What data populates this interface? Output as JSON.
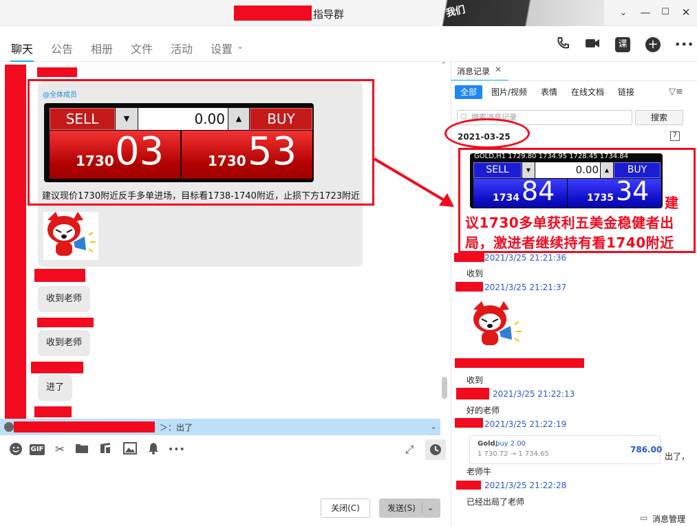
{
  "window": {
    "title": "指导群",
    "banner_text": "我们"
  },
  "tabs": [
    "聊天",
    "公告",
    "相册",
    "文件",
    "活动",
    "设置"
  ],
  "messages": {
    "mention": "@全体成员",
    "trade1": {
      "sell": "SELL",
      "buy": "BUY",
      "qty": "0.00",
      "sell_small": "1730",
      "sell_big": "03",
      "buy_small": "1730",
      "buy_big": "53"
    },
    "text1": "建议现价1730附近反手多单进场，目标看1738-1740附近，止损下方1723附近",
    "reply1": "收到老师",
    "reply2": "收到老师",
    "reply3": "进了",
    "notify": "＞：出了"
  },
  "buttons": {
    "close": "关闭(C)",
    "send": "发送(S)"
  },
  "history": {
    "tab_label": "消息记录",
    "filters": [
      "全部",
      "图片/视频",
      "表情",
      "在线文档",
      "链接"
    ],
    "search_placeholder": "搜索消息记录",
    "search_btn": "搜索",
    "date": "2021-03-25",
    "trade2": {
      "header": "GOLD,H1  1729.80 1734.95 1728.45 1734.84",
      "sell": "SELL",
      "buy": "BUY",
      "qty": "0.00",
      "sell_small": "1734",
      "sell_big": "84",
      "buy_small": "1735",
      "buy_big": "34"
    },
    "overlay": "建议1730多单获利五美金稳健者出局，激进者继续持有看1740附近",
    "entries": [
      {
        "time": "2021/3/25 21:21:36",
        "text": "收到"
      },
      {
        "time": "2021/3/25 21:21:37",
        "text": ""
      },
      {
        "time": "",
        "text": "收到"
      },
      {
        "time": "2021/3/25 21:22:13",
        "text": "好的老师"
      },
      {
        "time": "2021/3/25 21:22:19",
        "text": "出了，"
      },
      {
        "time": "",
        "text": "老师牛"
      },
      {
        "time": "2021/3/25 21:22:28",
        "text": "已经出局了老师"
      }
    ],
    "gold_card": {
      "symbol": "Gold,",
      "side": "buy 2.00",
      "route": "1 730.72 → 1 734.65",
      "profit": "786.00"
    },
    "manage": "消息管理"
  },
  "colors": {
    "accent": "#12b7f5",
    "redact": "#f20a1e",
    "link": "#2b56c6"
  }
}
